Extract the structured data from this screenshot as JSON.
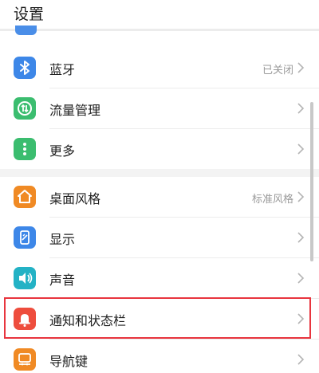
{
  "header": {
    "title": "设置"
  },
  "rows": [
    {
      "label": "蓝牙",
      "value": "已关闭",
      "icon": "bluetooth-icon",
      "color": "#3d87e8"
    },
    {
      "label": "流量管理",
      "value": "",
      "icon": "traffic-management-icon",
      "color": "#3bbd6f"
    },
    {
      "label": "更多",
      "value": "",
      "icon": "more-dots-icon",
      "color": "#3bbd6f"
    },
    {
      "label": "桌面风格",
      "value": "标准风格",
      "icon": "home-icon",
      "color": "#f08a24"
    },
    {
      "label": "显示",
      "value": "",
      "icon": "display-icon",
      "color": "#3d87e8"
    },
    {
      "label": "声音",
      "value": "",
      "icon": "speaker-icon",
      "color": "#23b2c5"
    },
    {
      "label": "通知和状态栏",
      "value": "",
      "icon": "bell-icon",
      "color": "#ee4d3d"
    },
    {
      "label": "导航键",
      "value": "",
      "icon": "navigation-key-icon",
      "color": "#f08a24"
    }
  ],
  "highlight_color": "#e8353e"
}
